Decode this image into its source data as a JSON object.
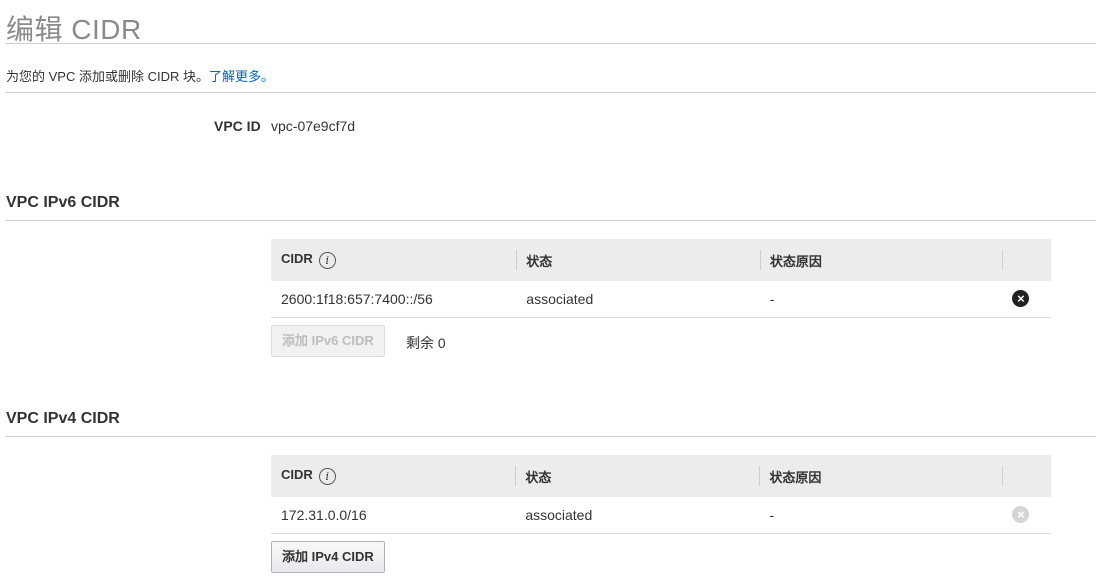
{
  "page": {
    "title": "编辑 CIDR",
    "description": "为您的 VPC 添加或删除 CIDR 块。",
    "learn_more": "了解更多。"
  },
  "vpc": {
    "label": "VPC ID",
    "value": "vpc-07e9cf7d"
  },
  "ipv6": {
    "section_title": "VPC IPv6 CIDR",
    "columns": [
      "CIDR",
      "状态",
      "状态原因"
    ],
    "rows": [
      {
        "cidr": "2600:1f18:657:7400::/56",
        "status": "associated",
        "reason": "-"
      }
    ],
    "add_button": "添加 IPv6 CIDR",
    "remaining": "剩余 0"
  },
  "ipv4": {
    "section_title": "VPC IPv4 CIDR",
    "columns": [
      "CIDR",
      "状态",
      "状态原因"
    ],
    "rows": [
      {
        "cidr": "172.31.0.0/16",
        "status": "associated",
        "reason": "-"
      }
    ],
    "add_button": "添加 IPv4 CIDR"
  },
  "icons": {
    "info": "i",
    "remove": "×"
  },
  "colors": {
    "link": "#0066c0",
    "status_associated": "#1d8102"
  }
}
